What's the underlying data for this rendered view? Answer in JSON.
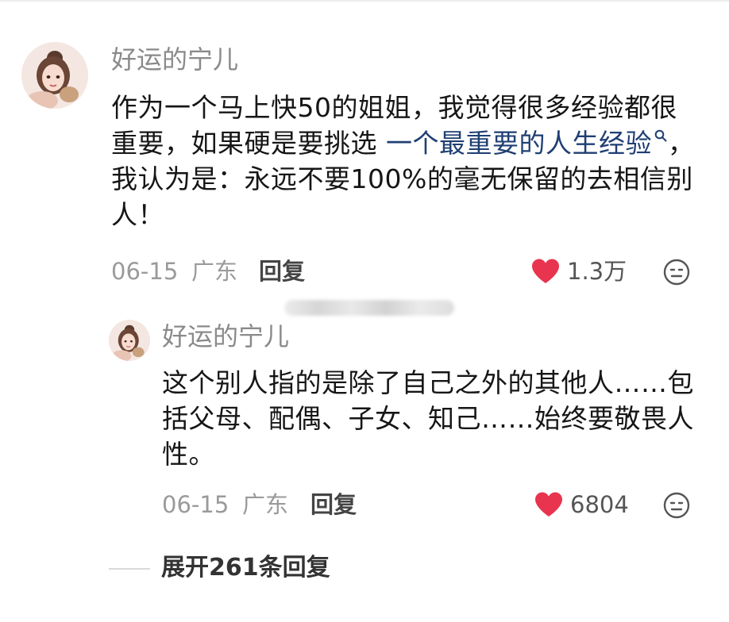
{
  "comment": {
    "username": "好运的宁儿",
    "text_part1": "作为一个马上快50的姐姐，我觉得很多经验都很重要，如果硬是要挑选 ",
    "link_text": "一个最重要的人生经验",
    "text_part2": "，我认为是：永远不要100%的毫无保留的去相信别人！",
    "date": "06-15",
    "location": "广东",
    "reply_label": "回复",
    "likes": "1.3万"
  },
  "reply": {
    "username": "好运的宁儿",
    "text": "这个别人指的是除了自己之外的其他人……包括父母、配偶、子女、知己……始终要敬畏人性。",
    "date": "06-15",
    "location": "广东",
    "reply_label": "回复",
    "likes": "6804"
  },
  "expand_replies_label": "展开261条回复",
  "colors": {
    "heart": "#e8344e",
    "link": "#1f3f73",
    "username": "#8a8a8a",
    "meta": "#9a9a9a"
  },
  "icons": {
    "like": "heart-icon",
    "emoji": "emoji-face-icon",
    "search": "search-icon"
  }
}
